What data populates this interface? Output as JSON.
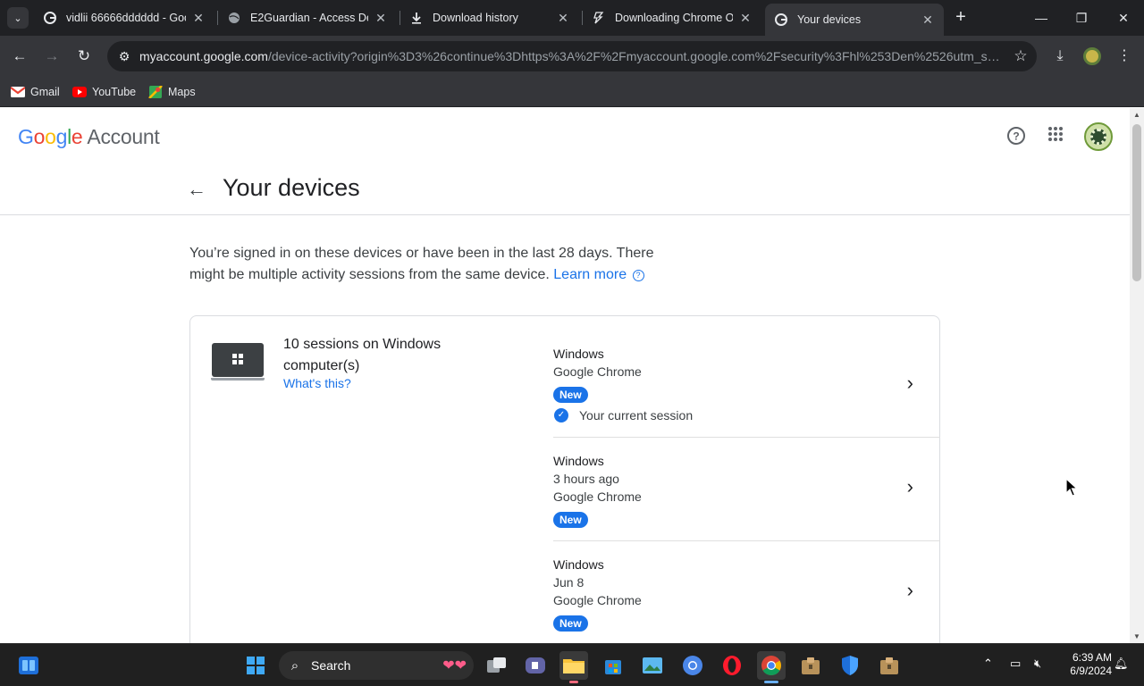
{
  "browser": {
    "tabs": [
      {
        "title": "vidlii 66666dddddd - Goo",
        "active": false
      },
      {
        "title": "E2Guardian - Access Den",
        "active": false
      },
      {
        "title": "Download history",
        "active": false
      },
      {
        "title": "Downloading Chrome OS",
        "active": false
      },
      {
        "title": "Your devices",
        "active": true
      }
    ],
    "url_host": "myaccount.google.com",
    "url_path": "/device-activity?origin%3D3%26continue%3Dhttps%3A%2F%2Fmyaccount.google.com%2Fsecurity%3Fhl%253Den%2526utm_sour...",
    "bookmarks": [
      {
        "label": "Gmail",
        "icon": "gmail-icon"
      },
      {
        "label": "YouTube",
        "icon": "youtube-icon"
      },
      {
        "label": "Maps",
        "icon": "maps-icon"
      }
    ]
  },
  "header": {
    "logo_google": "Google",
    "logo_account": "Account"
  },
  "page": {
    "title": "Your devices",
    "intro_text": "You’re signed in on these devices or have been in the last 28 days. There might be multiple activity sessions from the same device.",
    "learn_more": "Learn more",
    "help_glyph": "?"
  },
  "device_group": {
    "title": "10 sessions on Windows computer(s)",
    "whats_this": "What's this?",
    "sessions": [
      {
        "os": "Windows",
        "time": "",
        "browser": "Google Chrome",
        "badge": "New",
        "current": "Your current session"
      },
      {
        "os": "Windows",
        "time": "3 hours ago",
        "browser": "Google Chrome",
        "badge": "New",
        "current": ""
      },
      {
        "os": "Windows",
        "time": "Jun 8",
        "browser": "Google Chrome",
        "badge": "New",
        "current": ""
      }
    ]
  },
  "taskbar": {
    "search_placeholder": "Search",
    "time": "6:39 AM",
    "date": "6/9/2024"
  },
  "colors": {
    "accent": "#1a73e8",
    "browser_dark": "#202124",
    "taskbar": "#202020"
  }
}
